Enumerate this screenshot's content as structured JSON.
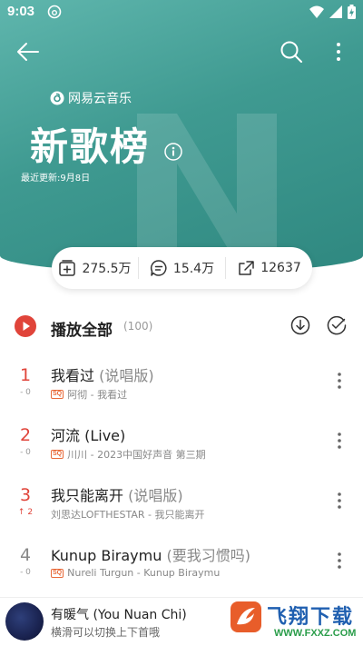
{
  "status_bar": {
    "time": "9:03"
  },
  "header": {
    "brand": "网易云音乐",
    "title": "新歌榜",
    "updated": "最近更新:9月8日"
  },
  "stats": {
    "collect_count": "275.5万",
    "comment_count": "15.4万",
    "share_count": "12637"
  },
  "play_all": {
    "label": "播放全部",
    "count": "(100)"
  },
  "songs": [
    {
      "rank": "1",
      "change": "- 0",
      "title": "我看过",
      "subtitle": " (说唱版)",
      "badge": "SQ",
      "meta": "阿彻 - 我看过"
    },
    {
      "rank": "2",
      "change": "- 0",
      "title": "河流 (Live)",
      "subtitle": "",
      "badge": "SQ",
      "meta": "川川 - 2023中国好声音 第三期"
    },
    {
      "rank": "3",
      "change": "↑ 2",
      "title": "我只能离开",
      "subtitle": " (说唱版)",
      "badge": "",
      "meta": "刘思达LOFTHESTAR - 我只能离开"
    },
    {
      "rank": "4",
      "change": "- 0",
      "title": "Kunup Biraymu",
      "subtitle": " (要我习惯吗)",
      "badge": "SQ",
      "meta": "Nureli Turgun - Kunup Biraymu"
    }
  ],
  "mini_player": {
    "title": "有暖气 (You Nuan Chi)",
    "hint": "横滑可以切换上下首哦"
  },
  "watermark": {
    "text": "飞翔下载",
    "url": "WWW.FXXZ.COM"
  },
  "colors": {
    "hero": "#3f9a91",
    "accent_red": "#e0443a",
    "badge": "#e86a3a"
  }
}
